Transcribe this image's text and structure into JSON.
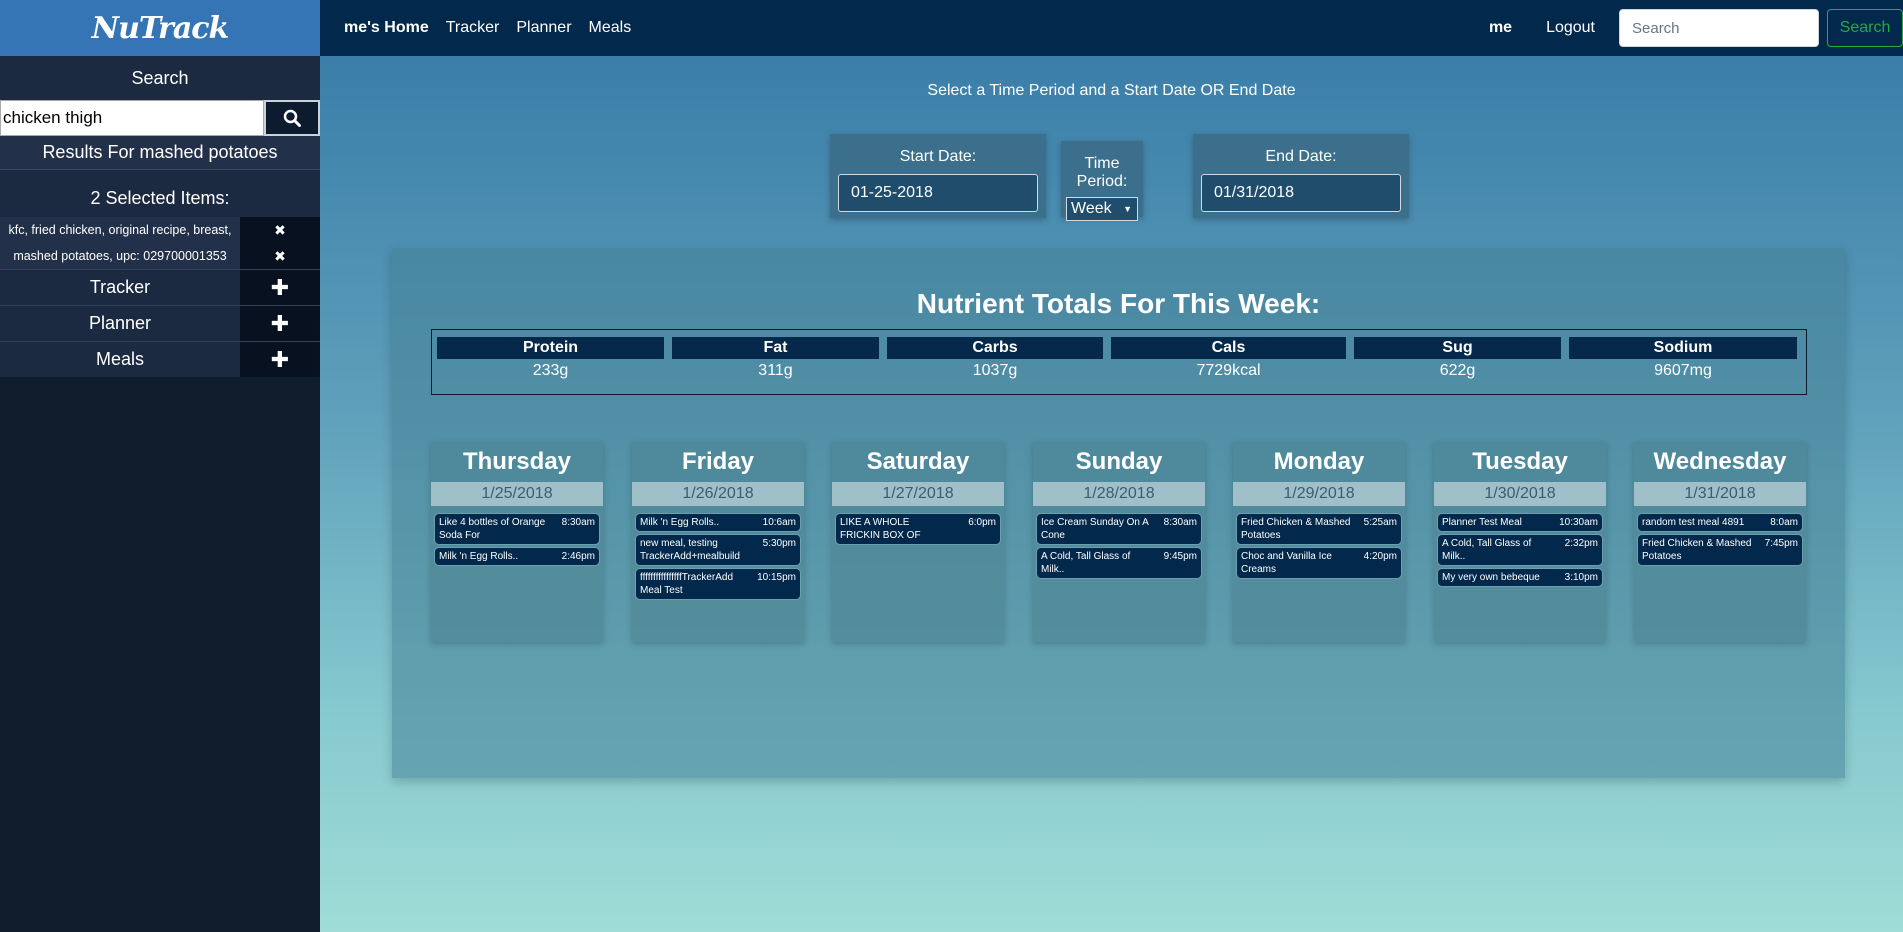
{
  "nav": {
    "brand": "NuTrack",
    "home": "me's Home",
    "links": [
      "Tracker",
      "Planner",
      "Meals"
    ],
    "user": "me",
    "logout": "Logout",
    "search_placeholder": "Search",
    "search_button": "Search"
  },
  "sidebar": {
    "search_label": "Search",
    "search_value": "chicken thigh",
    "results_label": "Results For mashed potatoes",
    "selected_label": "2 Selected Items:",
    "selected_items": [
      "kfc, fried chicken, original recipe, breast,",
      "mashed potatoes, upc: 029700001353"
    ],
    "sections": [
      "Tracker",
      "Planner",
      "Meals"
    ]
  },
  "main": {
    "instruction": "Select a Time Period and a Start Date OR End Date",
    "start_label": "Start Date:",
    "start_value": "01-25-2018",
    "period_label": "Time Period:",
    "period_value": "Week",
    "end_label": "End Date:",
    "end_value": "01/31/2018",
    "totals_title": "Nutrient Totals For This Week:",
    "totals": [
      {
        "name": "Protein",
        "value": "233g"
      },
      {
        "name": "Fat",
        "value": "311g"
      },
      {
        "name": "Carbs",
        "value": "1037g"
      },
      {
        "name": "Cals",
        "value": "7729kcal"
      },
      {
        "name": "Sug",
        "value": "622g"
      },
      {
        "name": "Sodium",
        "value": "9607mg"
      }
    ],
    "days": [
      {
        "name": "Thursday",
        "date": "1/25/2018",
        "meals": [
          {
            "name": "Like 4 bottles of Orange Soda For",
            "time": "8:30am"
          },
          {
            "name": "Milk 'n Egg Rolls..",
            "time": "2:46pm"
          }
        ]
      },
      {
        "name": "Friday",
        "date": "1/26/2018",
        "meals": [
          {
            "name": "Milk 'n Egg Rolls..",
            "time": "10:6am"
          },
          {
            "name": "new meal, testing TrackerAdd+mealbuild",
            "time": "5:30pm"
          },
          {
            "name": "ffffffffffffffffTrackerAdd Meal Test",
            "time": "10:15pm"
          }
        ]
      },
      {
        "name": "Saturday",
        "date": "1/27/2018",
        "meals": [
          {
            "name": "LIKE A WHOLE FRICKIN BOX OF",
            "time": "6:0pm"
          }
        ]
      },
      {
        "name": "Sunday",
        "date": "1/28/2018",
        "meals": [
          {
            "name": "Ice Cream Sunday On A Cone",
            "time": "8:30am"
          },
          {
            "name": "A Cold, Tall Glass of Milk..",
            "time": "9:45pm"
          }
        ]
      },
      {
        "name": "Monday",
        "date": "1/29/2018",
        "meals": [
          {
            "name": "Fried Chicken & Mashed Potatoes",
            "time": "5:25am"
          },
          {
            "name": "Choc and Vanilla Ice Creams",
            "time": "4:20pm"
          }
        ]
      },
      {
        "name": "Tuesday",
        "date": "1/30/2018",
        "meals": [
          {
            "name": "Planner Test Meal",
            "time": "10:30am"
          },
          {
            "name": "A Cold, Tall Glass of Milk..",
            "time": "2:32pm"
          },
          {
            "name": "My very own bebeque",
            "time": "3:10pm"
          }
        ]
      },
      {
        "name": "Wednesday",
        "date": "1/31/2018",
        "meals": [
          {
            "name": "random test meal 4891",
            "time": "8:0am"
          },
          {
            "name": "Fried Chicken & Mashed Potatoes",
            "time": "7:45pm"
          }
        ]
      }
    ]
  }
}
